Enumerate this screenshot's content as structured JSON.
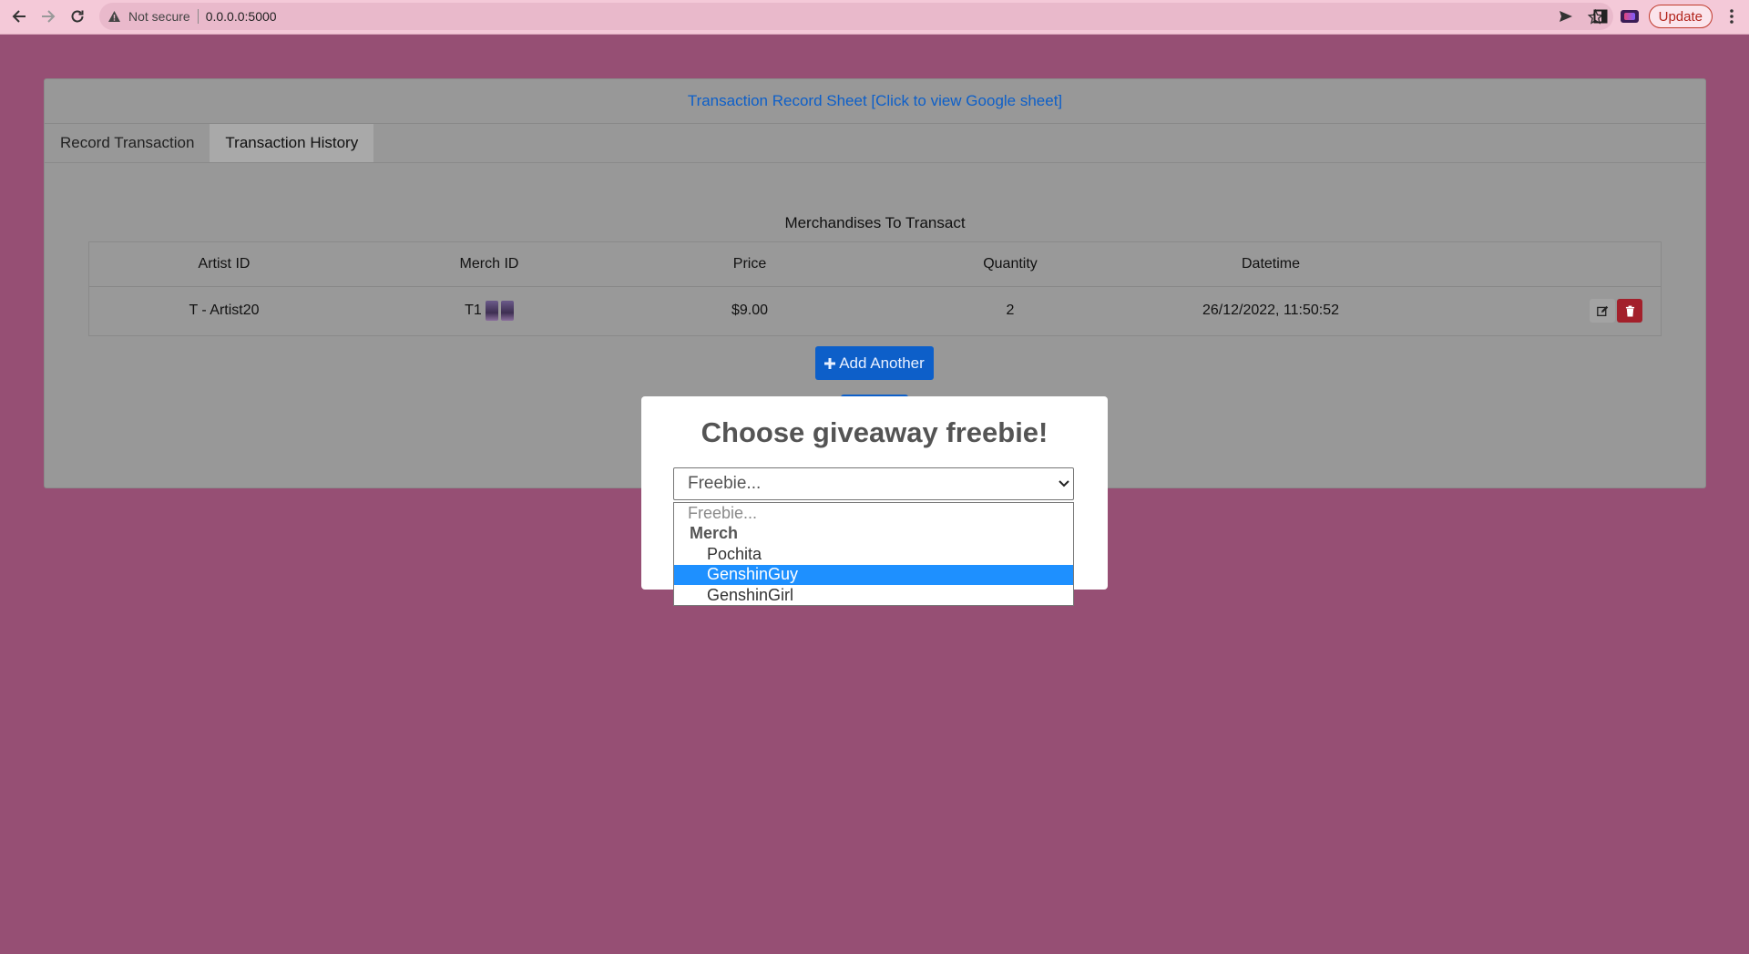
{
  "browser": {
    "security_label": "Not secure",
    "url": "0.0.0.0:5000",
    "update_label": "Update"
  },
  "page": {
    "sheet_link": "Transaction Record Sheet [Click to view Google sheet]",
    "tabs": [
      {
        "label": "Record Transaction",
        "active": true
      },
      {
        "label": "Transaction History",
        "active": false
      }
    ],
    "section_title": "Merchandises To Transact",
    "table": {
      "headers": [
        "Artist ID",
        "Merch ID",
        "Price",
        "Quantity",
        "Datetime"
      ],
      "rows": [
        {
          "artist_id": "T - Artist20",
          "merch_id": "T1",
          "price": "$9.00",
          "quantity": "2",
          "datetime": "26/12/2022, 11:50:52"
        }
      ]
    },
    "add_another_label": "Add Another"
  },
  "modal": {
    "title": "Choose giveaway freebie!",
    "select_value": "Freebie...",
    "options": {
      "placeholder": "Freebie...",
      "group_label": "Merch",
      "items": [
        "Pochita",
        "GenshinGuy",
        "GenshinGirl"
      ],
      "highlighted": "GenshinGuy"
    }
  },
  "colors": {
    "background": "#964f74",
    "accent": "#0d5fc9",
    "danger": "#a3202b",
    "highlight": "#1e90ff"
  }
}
